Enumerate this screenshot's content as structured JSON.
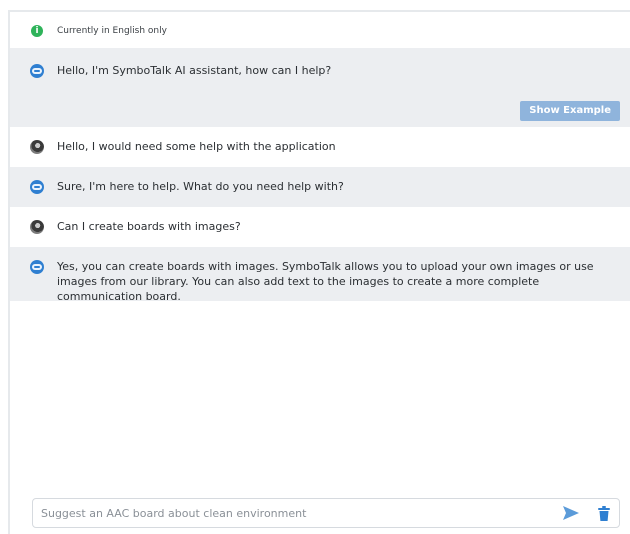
{
  "notice": {
    "text": "Currently in English only",
    "icon": "info-icon",
    "icon_color": "#2fb35a"
  },
  "messages": [
    {
      "role": "assistant",
      "text": "Hello, I'm SymboTalk AI assistant, how can I help?"
    },
    {
      "role": "user",
      "text": "Hello, I would need some help with the application"
    },
    {
      "role": "assistant",
      "text": "Sure, I'm here to help. What do you need help with?"
    },
    {
      "role": "user",
      "text": "Can I create boards with images?"
    },
    {
      "role": "assistant",
      "text": "Yes, you can create boards with images. SymboTalk allows you to upload your own images or use images from our library. You can also add text to the images to create a more complete communication board."
    }
  ],
  "show_example_label": "Show Example",
  "input": {
    "value": "",
    "placeholder": "Suggest an AAC board about clean environment"
  },
  "icons": {
    "send": "send-icon",
    "delete": "trash-icon",
    "assistant_avatar": "bot-avatar",
    "user_avatar": "user-avatar"
  },
  "colors": {
    "accent": "#2f7fd1",
    "button": "#8fb4dc",
    "assistant_bg": "#eceef1",
    "user_bg": "#ffffff"
  }
}
